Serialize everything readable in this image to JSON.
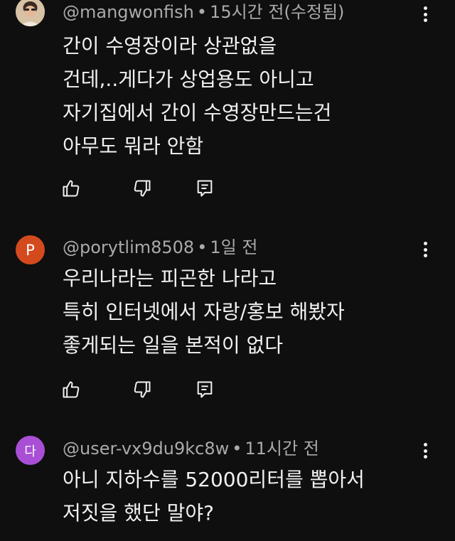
{
  "comments": [
    {
      "avatar_letter": "",
      "avatar_color": "#c9a98a",
      "author": "@mangwonfish",
      "time": "15시간 전(수정됨)",
      "lines": [
        "간이 수영장이라 상관없을",
        "건데,..게다가 상업용도 아니고",
        "자기집에서 간이 수영장만드는건",
        "아무도 뭐라 안함"
      ]
    },
    {
      "avatar_letter": "P",
      "avatar_color": "#d44a1f",
      "author": "@porytlim8508",
      "time": "1일 전",
      "lines": [
        "우리나라는 피곤한 나라고",
        "특히 인터넷에서 자랑/홍보 해봤자",
        "좋게되는 일을 본적이 없다"
      ]
    },
    {
      "avatar_letter": "다",
      "avatar_color": "#a94fd6",
      "author": "@user-vx9du9kc8w",
      "time": "11시간 전",
      "lines": [
        "아니 지하수를 52000리터를 뽑아서",
        "저짓을 했단 말야?"
      ]
    }
  ],
  "separator": "•",
  "icons": {
    "like": "thumbs-up-icon",
    "dislike": "thumbs-down-icon",
    "reply": "reply-icon",
    "more": "more-vertical-icon"
  }
}
